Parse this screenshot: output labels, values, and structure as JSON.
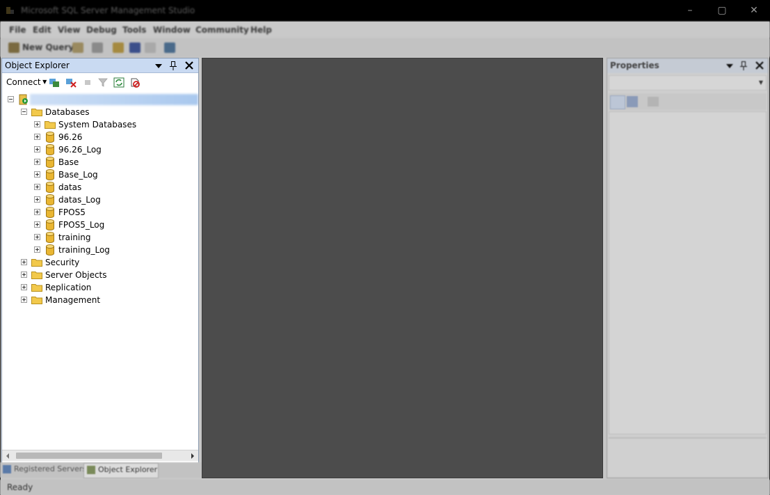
{
  "window": {
    "title": "Microsoft SQL Server Management Studio",
    "minimize": "–",
    "maximize": "▢",
    "close": "✕"
  },
  "menu": [
    "File",
    "Edit",
    "View",
    "Debug",
    "Tools",
    "Window",
    "Community",
    "Help"
  ],
  "toolbar": {
    "new_query": "New Query"
  },
  "object_explorer": {
    "title": "Object Explorer",
    "connect": "Connect",
    "server_label": "",
    "tree": {
      "databases": "Databases",
      "system_databases": "System Databases",
      "dbs": [
        "96.26",
        "96.26_Log",
        "Base",
        "Base_Log",
        "datas",
        "datas_Log",
        "FPOS5",
        "FPOS5_Log",
        "training",
        "training_Log"
      ],
      "security": "Security",
      "server_objects": "Server Objects",
      "replication": "Replication",
      "management": "Management"
    }
  },
  "bottom_tabs": {
    "registered_servers": "Registered Servers",
    "object_explorer": "Object Explorer"
  },
  "properties": {
    "title": "Properties"
  },
  "status": {
    "text": "Ready"
  },
  "colors": {
    "panel_header": "#c9daf2",
    "folder": "#f2c94c",
    "database": "#e9b633",
    "doc_bg": "#4c4c4c"
  }
}
